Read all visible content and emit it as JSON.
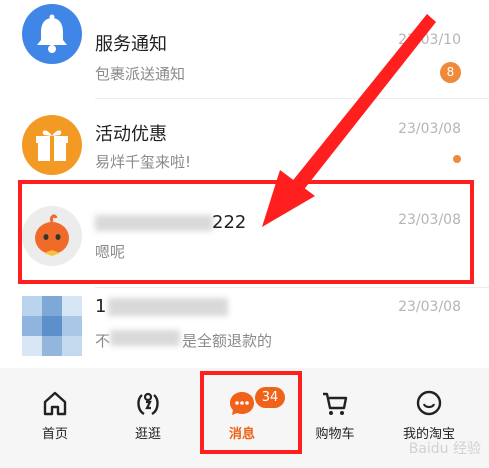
{
  "messages": [
    {
      "title": "服务通知",
      "subtitle": "包裹派送通知",
      "date": "23/03/10",
      "badge": "8",
      "icon": "bell-icon",
      "color": "#3f86e6"
    },
    {
      "title": "活动优惠",
      "subtitle": "易烊千玺来啦!",
      "date": "23/03/08",
      "icon": "gift-icon",
      "color": "#f39a25"
    },
    {
      "title": "222",
      "subtitle": "嗯呢",
      "date": "23/03/08",
      "icon": "mascot-avatar"
    },
    {
      "title": "1",
      "subtitle_prefix": "不",
      "subtitle": "是全额退款的",
      "date": "23/03/08",
      "icon": "pixelated-avatar"
    }
  ],
  "tabs": [
    {
      "label": "首页",
      "icon": "home-icon"
    },
    {
      "label": "逛逛",
      "icon": "stroll-icon"
    },
    {
      "label": "消息",
      "icon": "message-icon",
      "badge": "34",
      "active": true
    },
    {
      "label": "购物车",
      "icon": "cart-icon"
    },
    {
      "label": "我的淘宝",
      "icon": "smile-icon"
    }
  ],
  "watermark": "Baidu 经验",
  "colors": {
    "accent": "#f06218",
    "annotation_red": "#ff1f1f",
    "bell_blue": "#3f86e6",
    "gift_orange": "#f39a25"
  }
}
